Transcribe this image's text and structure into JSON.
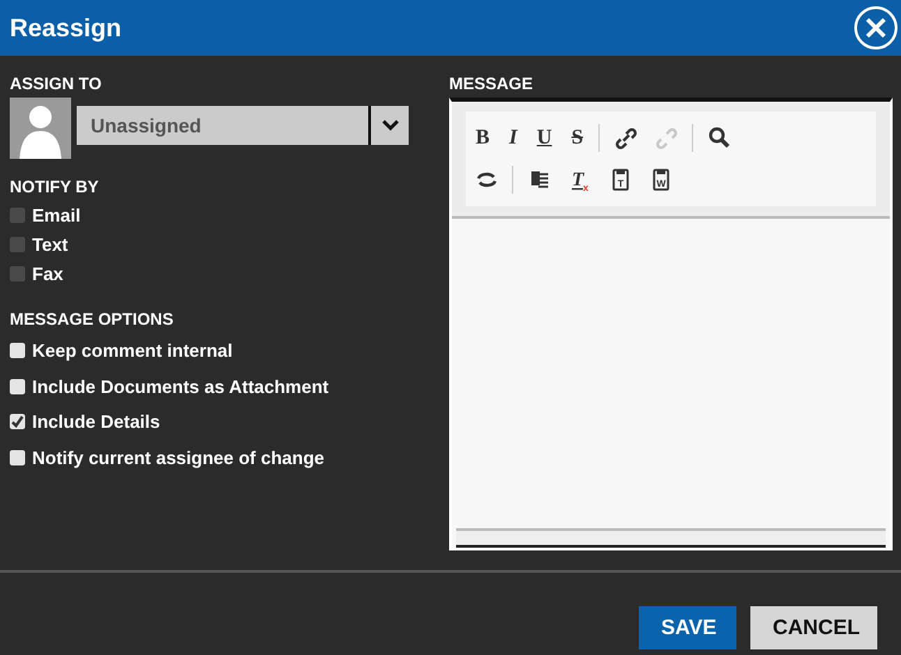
{
  "window": {
    "title": "Reassign"
  },
  "assign_to": {
    "label": "ASSIGN TO",
    "value": "Unassigned"
  },
  "notify_by": {
    "label": "NOTIFY BY",
    "options": [
      {
        "label": "Email",
        "checked": false,
        "disabled": true
      },
      {
        "label": "Text",
        "checked": false,
        "disabled": true
      },
      {
        "label": "Fax",
        "checked": false,
        "disabled": true
      }
    ]
  },
  "message_options": {
    "label": "MESSAGE OPTIONS",
    "options": [
      {
        "label": "Keep comment internal",
        "checked": false,
        "disabled": false
      },
      {
        "label": "Include Documents as Attachment",
        "checked": false,
        "disabled": false
      },
      {
        "label": "Include Details",
        "checked": true,
        "disabled": false
      },
      {
        "label": "Notify current assignee of change",
        "checked": false,
        "disabled": false
      }
    ]
  },
  "message": {
    "label": "MESSAGE",
    "toolbar": [
      [
        {
          "kind": "bold",
          "glyph": "B",
          "disabled": false
        },
        {
          "kind": "italic",
          "glyph": "I",
          "disabled": false
        },
        {
          "kind": "underline",
          "glyph": "U",
          "disabled": false
        },
        {
          "kind": "strike",
          "glyph": "S",
          "disabled": false
        },
        {
          "kind": "sep"
        },
        {
          "kind": "link",
          "disabled": false
        },
        {
          "kind": "unlink",
          "disabled": true
        },
        {
          "kind": "sep"
        },
        {
          "kind": "find",
          "disabled": false
        }
      ],
      [
        {
          "kind": "replace",
          "disabled": false
        },
        {
          "kind": "sep"
        },
        {
          "kind": "paste",
          "disabled": false
        },
        {
          "kind": "clear",
          "glyph": "T",
          "sub": "x",
          "disabled": false
        },
        {
          "kind": "template",
          "glyph": "T",
          "disabled": false
        },
        {
          "kind": "template",
          "glyph": "W",
          "disabled": false
        }
      ]
    ]
  },
  "buttons": [
    {
      "label": "SAVE",
      "kind": "primary"
    },
    {
      "label": "CANCEL",
      "kind": "secondary"
    }
  ]
}
